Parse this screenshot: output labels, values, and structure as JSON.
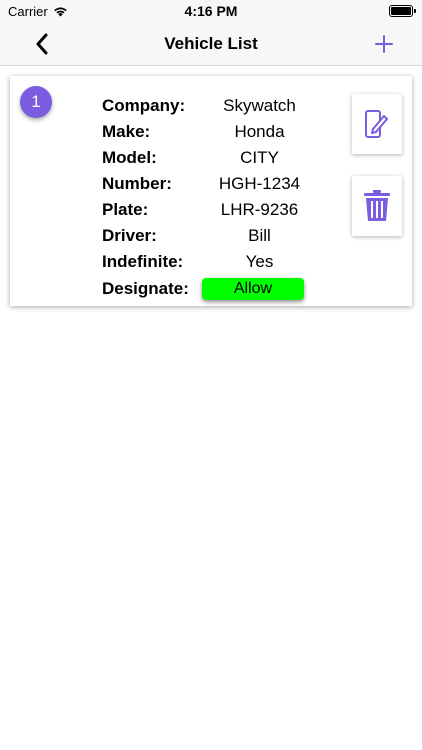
{
  "status_bar": {
    "carrier": "Carrier",
    "time": "4:16 PM"
  },
  "nav": {
    "title": "Vehicle List",
    "back_icon": "chevron-left-icon",
    "add_icon": "plus-icon",
    "accent_color": "#7b5ce0"
  },
  "vehicles": [
    {
      "index": "1",
      "fields": [
        {
          "label": "Company:",
          "value": "Skywatch"
        },
        {
          "label": "Make:",
          "value": "Honda"
        },
        {
          "label": "Model:",
          "value": "CITY"
        },
        {
          "label": "Number:",
          "value": "HGH-1234"
        },
        {
          "label": "Plate:",
          "value": "LHR-9236"
        },
        {
          "label": "Driver:",
          "value": "Bill"
        },
        {
          "label": "Indefinite:",
          "value": "Yes"
        },
        {
          "label": "Designate:",
          "value": "Allow"
        }
      ],
      "designate_color": "#00ff00",
      "actions": {
        "edit_icon": "edit-icon",
        "delete_icon": "trash-icon"
      }
    }
  ]
}
